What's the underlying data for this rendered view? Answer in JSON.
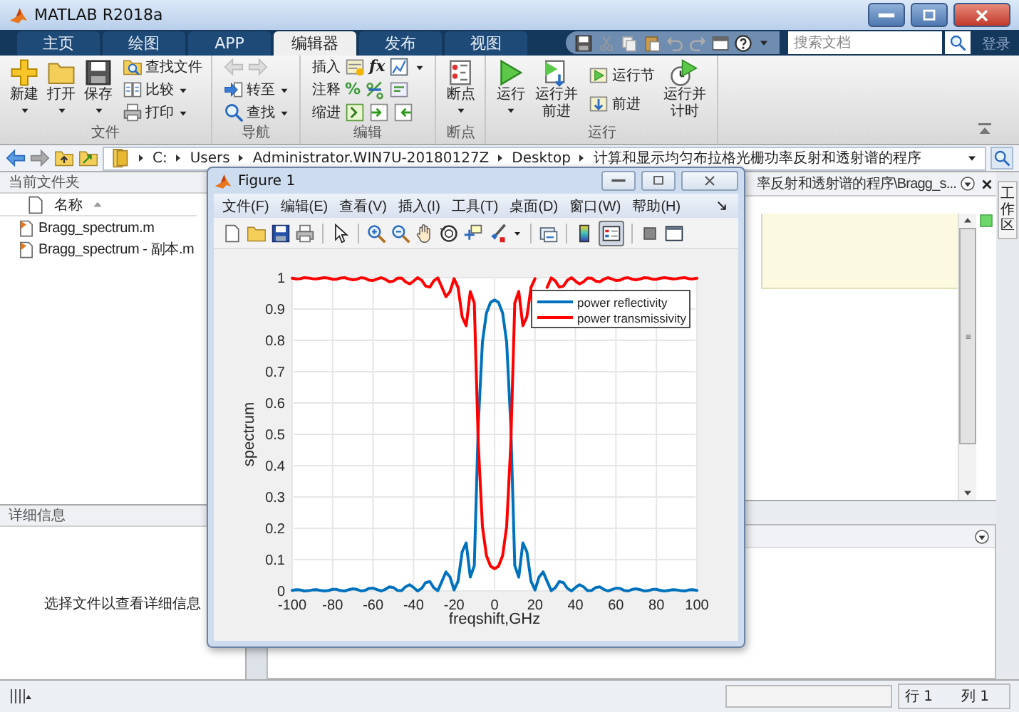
{
  "window": {
    "title": "MATLAB R2018a"
  },
  "tabs": [
    {
      "label": "主页",
      "selected": false
    },
    {
      "label": "绘图",
      "selected": false
    },
    {
      "label": "APP",
      "selected": false
    },
    {
      "label": "编辑器",
      "selected": true
    },
    {
      "label": "发布",
      "selected": false
    },
    {
      "label": "视图",
      "selected": false
    }
  ],
  "search": {
    "placeholder": "搜索文档"
  },
  "login": "登录",
  "ribbon": {
    "file": {
      "label": "文件",
      "new": "新建",
      "open": "打开",
      "save": "保存",
      "find_files": "查找文件",
      "compare": "比较",
      "print": "打印"
    },
    "navigate": {
      "label": "导航",
      "go_to": "转至",
      "find": "查找"
    },
    "edit": {
      "label": "编辑",
      "insert": "插入",
      "comment": "注释",
      "indent": "缩进",
      "fx": "fx",
      "percent": "%"
    },
    "breakpoints": {
      "label": "断点",
      "breakpoints": "断点"
    },
    "run": {
      "label": "运行",
      "run": "运行",
      "run_advance": "运行并前进",
      "run_section": "运行节",
      "advance": "前进",
      "run_time": "运行并计时"
    }
  },
  "address": {
    "crumbs": [
      "C:",
      "Users",
      "Administrator.WIN7U-20180127Z",
      "Desktop",
      "计算和显示均匀布拉格光栅功率反射和透射谱的程序"
    ]
  },
  "current_folder": {
    "title": "当前文件夹",
    "column": "名称",
    "files": [
      "Bragg_spectrum.m",
      "Bragg_spectrum - 副本.m"
    ]
  },
  "details": {
    "title": "详细信息",
    "message": "选择文件以查看详细信息"
  },
  "editor": {
    "title": "率反射和透射谱的程序\\Bragg_s..."
  },
  "workspace_tab": "工作区",
  "status": {
    "line": "行 1",
    "column": "列 1"
  },
  "figure": {
    "title": "Figure 1",
    "menu": [
      "文件(F)",
      "编辑(E)",
      "查看(V)",
      "插入(I)",
      "工具(T)",
      "桌面(D)",
      "窗口(W)",
      "帮助(H)"
    ],
    "legend_pressed": true,
    "chart_data": {
      "type": "line",
      "grid": true,
      "legend": true,
      "xlabel": "freqshift,GHz",
      "ylabel": "spectrum",
      "xlim": [
        -100,
        100
      ],
      "ylim": [
        0,
        1
      ],
      "xticks": [
        -100,
        -80,
        -60,
        -40,
        -20,
        0,
        20,
        40,
        60,
        80,
        100
      ],
      "yticks": [
        0,
        0.1,
        0.2,
        0.3,
        0.4,
        0.5,
        0.6,
        0.7,
        0.8,
        0.9,
        1
      ],
      "x": [
        -100,
        -98,
        -96,
        -94,
        -92,
        -90,
        -88,
        -86,
        -84,
        -82,
        -80,
        -78,
        -76,
        -74,
        -72,
        -70,
        -68,
        -66,
        -64,
        -62,
        -60,
        -58,
        -56,
        -54,
        -52,
        -50,
        -48,
        -46,
        -44,
        -42,
        -40,
        -38,
        -36,
        -34,
        -32,
        -30,
        -28,
        -26,
        -24,
        -22,
        -20,
        -18,
        -16,
        -14,
        -12,
        -10,
        -8,
        -6,
        -4,
        -2,
        0,
        2,
        4,
        6,
        8,
        10,
        12,
        14,
        16,
        18,
        20,
        22,
        24,
        26,
        28,
        30,
        32,
        34,
        36,
        38,
        40,
        42,
        44,
        46,
        48,
        50,
        52,
        54,
        56,
        58,
        60,
        62,
        64,
        66,
        68,
        70,
        72,
        74,
        76,
        78,
        80,
        82,
        84,
        86,
        88,
        90,
        92,
        94,
        96,
        98,
        100
      ],
      "series": [
        {
          "name": "power reflectivity",
          "color": "#0072bd",
          "values": [
            0.002,
            0.004,
            0.003,
            0.0,
            0.001,
            0.003,
            0.004,
            0.002,
            0.0,
            0.002,
            0.005,
            0.005,
            0.001,
            0.0,
            0.004,
            0.007,
            0.005,
            0.0,
            0.002,
            0.008,
            0.009,
            0.004,
            0.0,
            0.005,
            0.013,
            0.011,
            0.002,
            0.001,
            0.013,
            0.02,
            0.011,
            0.0,
            0.008,
            0.027,
            0.03,
            0.01,
            0.001,
            0.031,
            0.061,
            0.044,
            0.003,
            0.031,
            0.125,
            0.153,
            0.044,
            0.081,
            0.531,
            0.794,
            0.887,
            0.921,
            0.929,
            0.921,
            0.887,
            0.794,
            0.531,
            0.081,
            0.044,
            0.153,
            0.125,
            0.031,
            0.003,
            0.044,
            0.061,
            0.031,
            0.001,
            0.01,
            0.03,
            0.027,
            0.008,
            0.0,
            0.011,
            0.02,
            0.013,
            0.001,
            0.002,
            0.011,
            0.013,
            0.005,
            0.0,
            0.004,
            0.009,
            0.008,
            0.002,
            0.0,
            0.005,
            0.007,
            0.004,
            0.0,
            0.001,
            0.005,
            0.005,
            0.002,
            0.0,
            0.002,
            0.004,
            0.003,
            0.001,
            0.0,
            0.003,
            0.004,
            0.002
          ]
        },
        {
          "name": "power transmissivity",
          "color": "#ff0000",
          "values": [
            0.998,
            0.996,
            0.997,
            1.0,
            0.999,
            0.997,
            0.996,
            0.998,
            1.0,
            0.998,
            0.995,
            0.995,
            0.999,
            1.0,
            0.996,
            0.993,
            0.995,
            1.0,
            0.998,
            0.992,
            0.991,
            0.996,
            1.0,
            0.995,
            0.987,
            0.989,
            0.998,
            0.999,
            0.987,
            0.98,
            0.989,
            1.0,
            0.992,
            0.973,
            0.97,
            0.99,
            0.999,
            0.969,
            0.939,
            0.956,
            0.997,
            0.969,
            0.875,
            0.847,
            0.956,
            0.919,
            0.469,
            0.206,
            0.113,
            0.079,
            0.071,
            0.079,
            0.113,
            0.206,
            0.469,
            0.919,
            0.956,
            0.847,
            0.875,
            0.969,
            0.997,
            null,
            null,
            0.969,
            0.999,
            0.99,
            0.97,
            0.973,
            0.992,
            1.0,
            0.989,
            0.98,
            0.987,
            0.999,
            0.998,
            0.989,
            0.987,
            0.995,
            1.0,
            0.996,
            0.991,
            0.992,
            0.998,
            1.0,
            0.995,
            0.993,
            0.996,
            1.0,
            0.999,
            0.995,
            0.995,
            0.998,
            1.0,
            0.998,
            0.996,
            0.997,
            0.999,
            1.0,
            0.997,
            0.996,
            0.998
          ]
        }
      ]
    }
  }
}
